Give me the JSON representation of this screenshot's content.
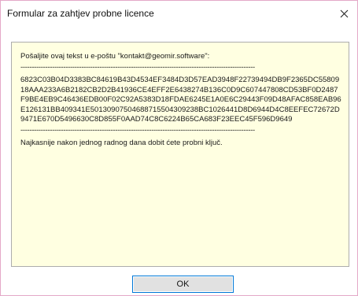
{
  "window": {
    "title": "Formular za zahtjev probne licence",
    "close_icon": "close-icon"
  },
  "panel": {
    "intro": "Pošaljite ovaj tekst u e-poštu \"kontakt@geomir.software\":",
    "separator_top": "--------------------------------------------------------------------------------------------------------",
    "code": "6823C03B04D3383BC84619B43D4534EF3484D3D57EAD3948F22739494DB9F2365DC5580918AAA233A6B2182CB2D2B41936CE4EFF2E6438274B136C0D9C607447808CD53BF0D2487F9BE4EB9C46436EDB00F02C92A5383D18FDAE6245E1A0E6C29443F09D48AFAC858EAB96E126131BB409341E50130907504688715504309238BC1026441D8D6944D4C8EEFEC72672D9471E670D5496630C8D855F0AAD74C8C6224B65CA683F23EEC45F596D9649",
    "separator_bottom": "--------------------------------------------------------------------------------------------------------",
    "footer": "Najkasnije nakon jednog radnog dana dobit ćete probni ključ."
  },
  "buttons": {
    "ok_label": "OK"
  },
  "colors": {
    "panel_background": "#ffffe1",
    "window_border": "#e4a8c8",
    "button_focus_border": "#0078d7"
  }
}
